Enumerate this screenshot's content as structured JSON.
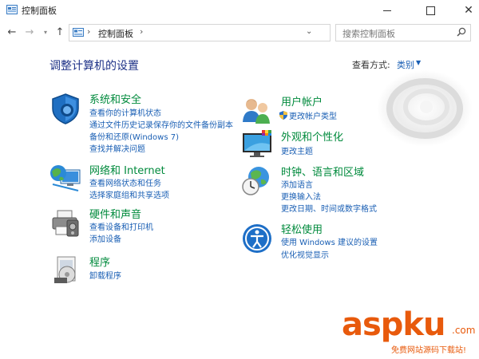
{
  "window": {
    "title": "控制面板"
  },
  "nav": {
    "back": "←",
    "forward": "→",
    "up": "↑",
    "refresh": "↻",
    "address_path": "控制面板",
    "address_sep": "›",
    "search_placeholder": "搜索控制面板"
  },
  "content": {
    "heading": "调整计算机的设置",
    "view_by_label": "查看方式:",
    "view_by_value": "类别"
  },
  "categories": [
    {
      "title": "系统和安全",
      "links": [
        "查看你的计算机状态",
        "通过文件历史记录保存你的文件备份副本",
        "备份和还原(Windows 7)",
        "查找并解决问题"
      ]
    },
    {
      "title": "网络和 Internet",
      "links": [
        "查看网络状态和任务",
        "选择家庭组和共享选项"
      ]
    },
    {
      "title": "硬件和声音",
      "links": [
        "查看设备和打印机",
        "添加设备"
      ]
    },
    {
      "title": "程序",
      "links": [
        "卸载程序"
      ]
    },
    {
      "title": "用户帐户",
      "links": [
        "更改帐户类型"
      ]
    },
    {
      "title": "外观和个性化",
      "links": [
        "更改主题"
      ]
    },
    {
      "title": "时钟、语言和区域",
      "links": [
        "添加语言",
        "更换输入法",
        "更改日期、时间或数字格式"
      ]
    },
    {
      "title": "轻松使用",
      "links": [
        "使用 Windows 建议的设置",
        "优化视觉显示"
      ]
    }
  ],
  "watermark": {
    "brand": "aspku",
    "suffix": ".com",
    "subtitle": "免费网站源码下载站!"
  },
  "colors": {
    "heading": "#1e3287",
    "category_title": "#008a3c",
    "link": "#1a5fb4",
    "watermark": "#e85a0c"
  }
}
